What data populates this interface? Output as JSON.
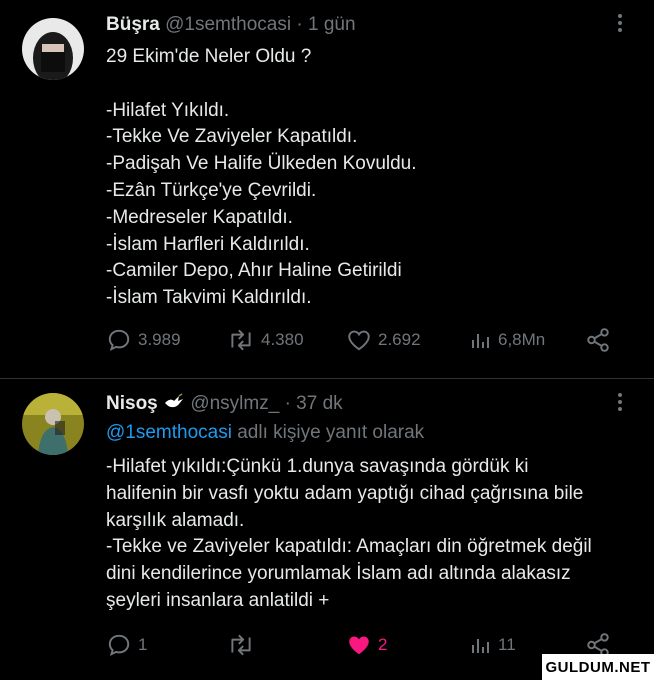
{
  "tweet1": {
    "name": "Büşra",
    "handle": "@1semthocasi",
    "time": "· 1 gün",
    "lines": [
      "29 Ekim'de Neler Oldu ?",
      "",
      "-Hilafet Yıkıldı.",
      "-Tekke Ve Zaviyeler Kapatıldı.",
      "-Padişah Ve Halife Ülkeden Kovuldu.",
      "-Ezân Türkçe'ye Çevrildi.",
      "-Medreseler Kapatıldı.",
      "-İslam Harfleri Kaldırıldı.",
      "-Camiler Depo, Ahır Haline Getirildi",
      "-İslam Takvimi Kaldırıldı."
    ],
    "replies": "3.989",
    "retweets": "4.380",
    "likes": "2.692",
    "views": "6,8Mn"
  },
  "tweet2": {
    "name": "Nisoş",
    "handle": "@nsylmz_",
    "time": "· 37 dk",
    "reply_mention": "@1semthocasi",
    "reply_suffix": " adlı kişiye yanıt olarak",
    "lines": [
      "-Hilafet yıkıldı:Çünkü 1.dunya savaşında gördük ki",
      "halifenin bir vasfı yoktu adam yaptığı cihad çağrısına bile",
      "karşılık alamadı.",
      "-Tekke ve Zaviyeler kapatıldı: Amaçları din öğretmek değil",
      "dini kendilerince yorumlamak İslam adı altında alakasız",
      "şeyleri insanlara anlatildi +"
    ],
    "replies": "1",
    "retweets": "",
    "likes": "2",
    "views": "11"
  },
  "icons": {
    "reply": "reply-bubble-icon",
    "retweet": "retweet-icon",
    "like": "heart-icon",
    "views": "views-bar-chart-icon",
    "share": "share-icon",
    "more": "more-dots-icon",
    "badge": "dove-emoji-icon"
  },
  "colors": {
    "background": "#000000",
    "text": "#e7e9ea",
    "muted": "#71767b",
    "link": "#1d9bf0",
    "liked": "#f91880"
  },
  "watermark": "GULDUM.NET"
}
